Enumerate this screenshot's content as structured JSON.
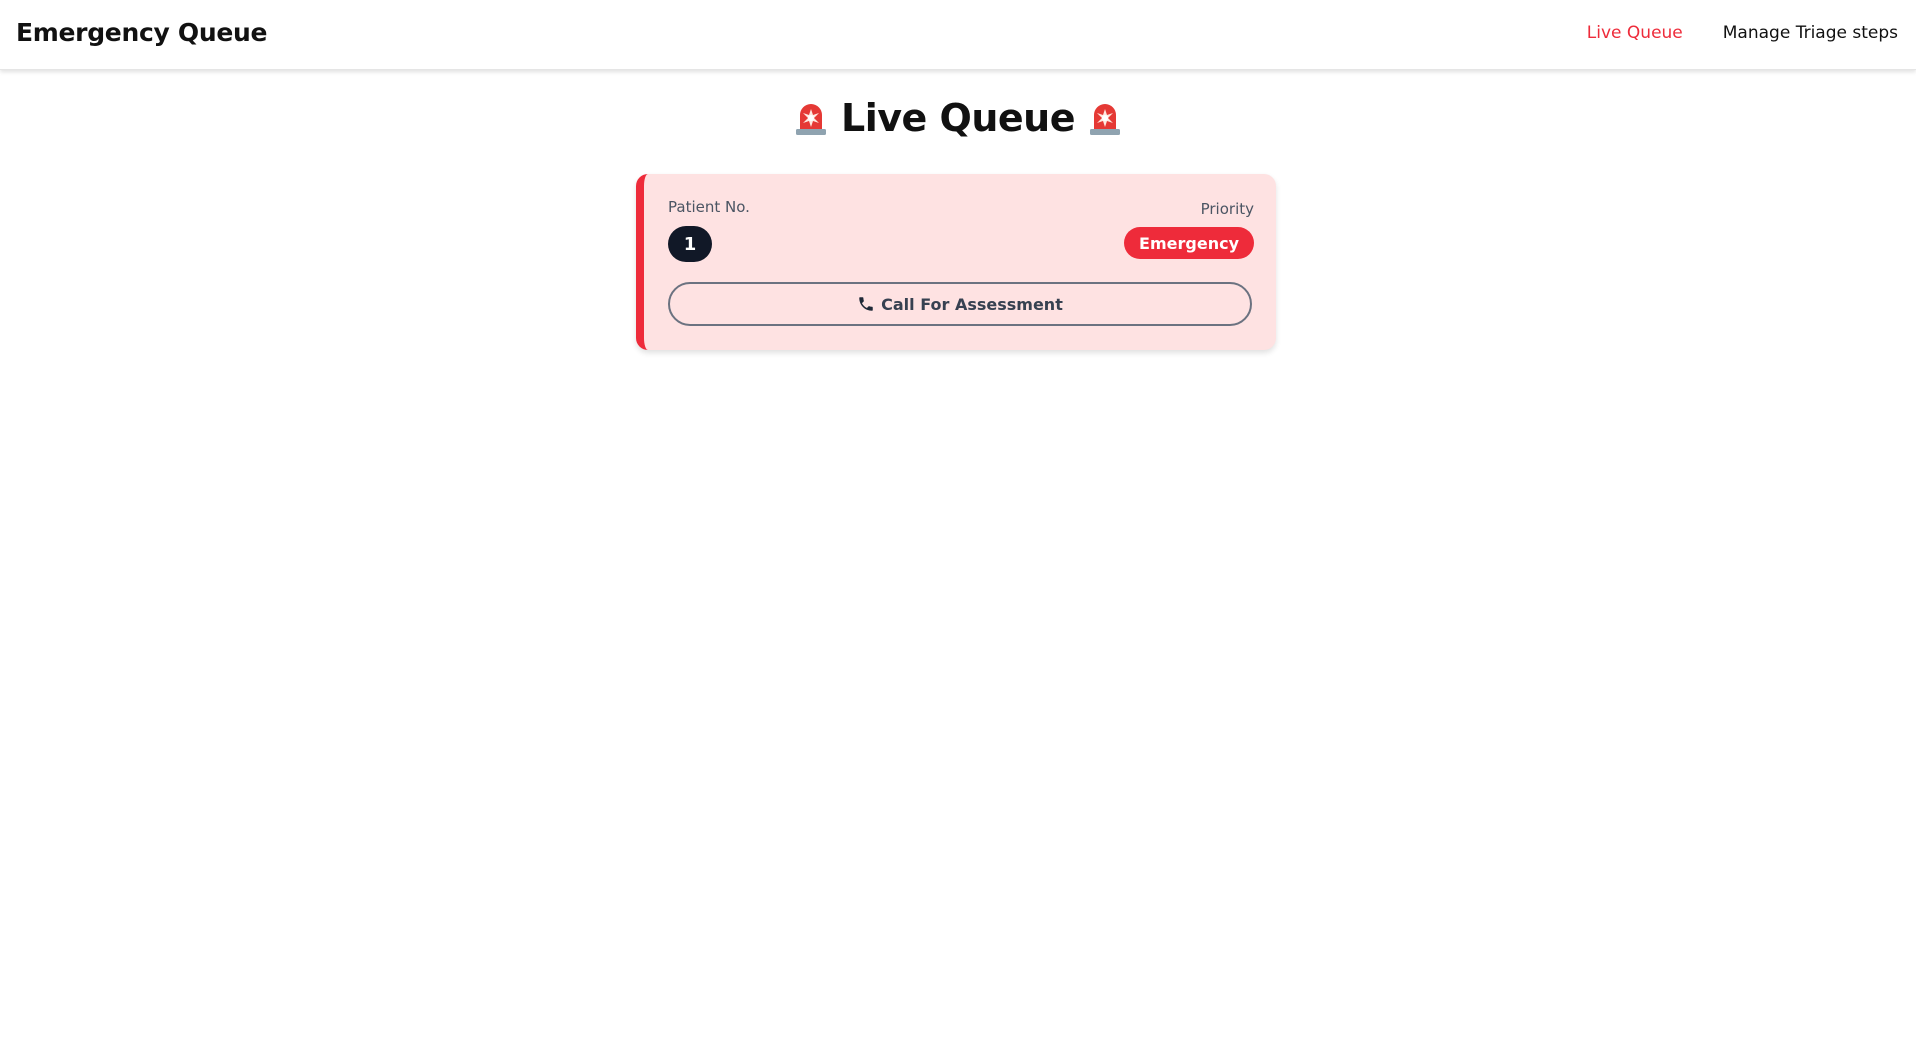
{
  "header": {
    "brand": "Emergency Queue",
    "nav": [
      {
        "label": "Live Queue",
        "active": true
      },
      {
        "label": "Manage Triage steps",
        "active": false
      }
    ]
  },
  "page": {
    "title": "Live Queue",
    "title_icon": "siren-icon"
  },
  "queue": [
    {
      "patient_label": "Patient No.",
      "patient_number": "1",
      "priority_label": "Priority",
      "priority": "Emergency",
      "call_button": "Call For Assessment",
      "call_icon": "phone-icon"
    }
  ],
  "colors": {
    "accent": "#ee2b3a",
    "card_bg": "#fee2e2",
    "badge_dark": "#111827"
  }
}
